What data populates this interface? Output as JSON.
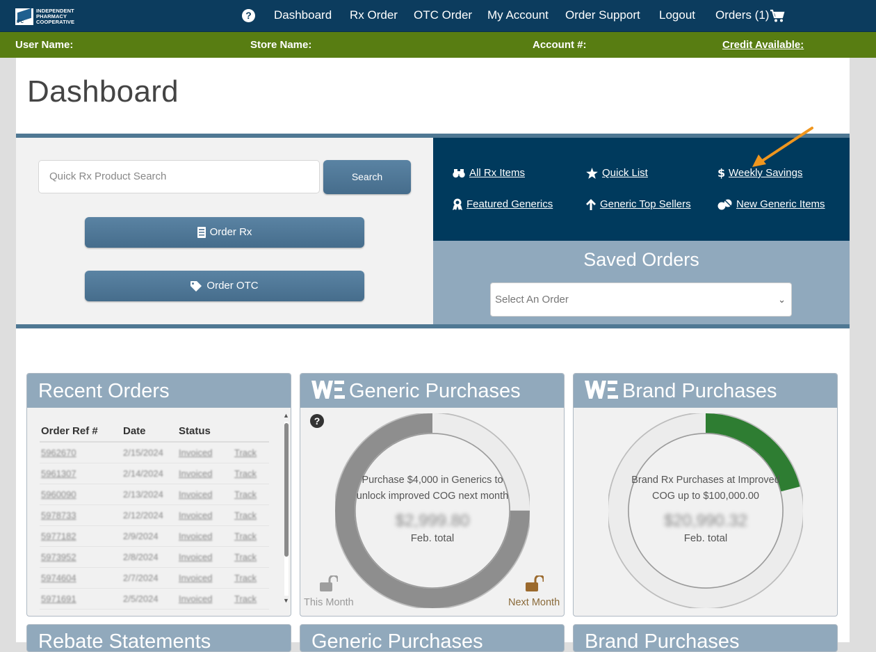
{
  "nav": {
    "logo_line1": "INDEPENDENT",
    "logo_line2": "PHARMACY",
    "logo_line3": "COOPERATIVE",
    "logo_mark": "IPC",
    "help": "?",
    "items": [
      "Dashboard",
      "Rx Order",
      "OTC Order",
      "My Account",
      "Order Support",
      "Logout",
      "Orders (1)"
    ]
  },
  "infobar": {
    "user_name": "User Name:",
    "store_name": "Store Name:",
    "account": "Account #:",
    "credit": "Credit Available:"
  },
  "page_title": "Dashboard",
  "search": {
    "placeholder": "Quick Rx Product Search",
    "button": "Search"
  },
  "buttons": {
    "order_rx": "Order Rx",
    "order_otc": "Order OTC"
  },
  "quick_links": [
    "All Rx Items",
    "Quick List",
    "Weekly Savings",
    "Featured Generics",
    "Generic Top Sellers",
    "New Generic Items"
  ],
  "saved_orders": {
    "title": "Saved Orders",
    "placeholder": "Select An Order"
  },
  "recent_orders": {
    "title": "Recent Orders",
    "columns": [
      "Order Ref #",
      "Date",
      "Status"
    ],
    "rows": [
      [
        "5962670",
        "2/15/2024",
        "Invoiced",
        "Track"
      ],
      [
        "5961307",
        "2/14/2024",
        "Invoiced",
        "Track"
      ],
      [
        "5960090",
        "2/13/2024",
        "Invoiced",
        "Track"
      ],
      [
        "5978733",
        "2/12/2024",
        "Invoiced",
        "Track"
      ],
      [
        "5977182",
        "2/9/2024",
        "Invoiced",
        "Track"
      ],
      [
        "5973952",
        "2/8/2024",
        "Invoiced",
        "Track"
      ],
      [
        "5974604",
        "2/7/2024",
        "Invoiced",
        "Track"
      ],
      [
        "5971691",
        "2/5/2024",
        "Invoiced",
        "Track"
      ]
    ]
  },
  "generic_purchases": {
    "title": "Generic Purchases",
    "message": "Purchase $4,000 in Generics to unlock improved COG next month",
    "amount": "$2,999.80",
    "period": "Feb. total",
    "progress": 0.75,
    "this_month": "This Month",
    "next_month": "Next Month"
  },
  "brand_purchases": {
    "title": "Brand Purchases",
    "message": "Brand Rx Purchases at Improved COG up to $100,000.00",
    "amount": "$20,990.32",
    "period": "Feb. total",
    "progress": 0.21
  },
  "bottom_cards": [
    "Rebate Statements",
    "Generic Purchases",
    "Brand Purchases"
  ],
  "colors": {
    "nav": "#0c3c5e",
    "info_bar": "#587d12",
    "generic_ring": "#8e8e8e",
    "brand_ring": "#2e7d32",
    "annotation_arrow": "#f0961e"
  }
}
